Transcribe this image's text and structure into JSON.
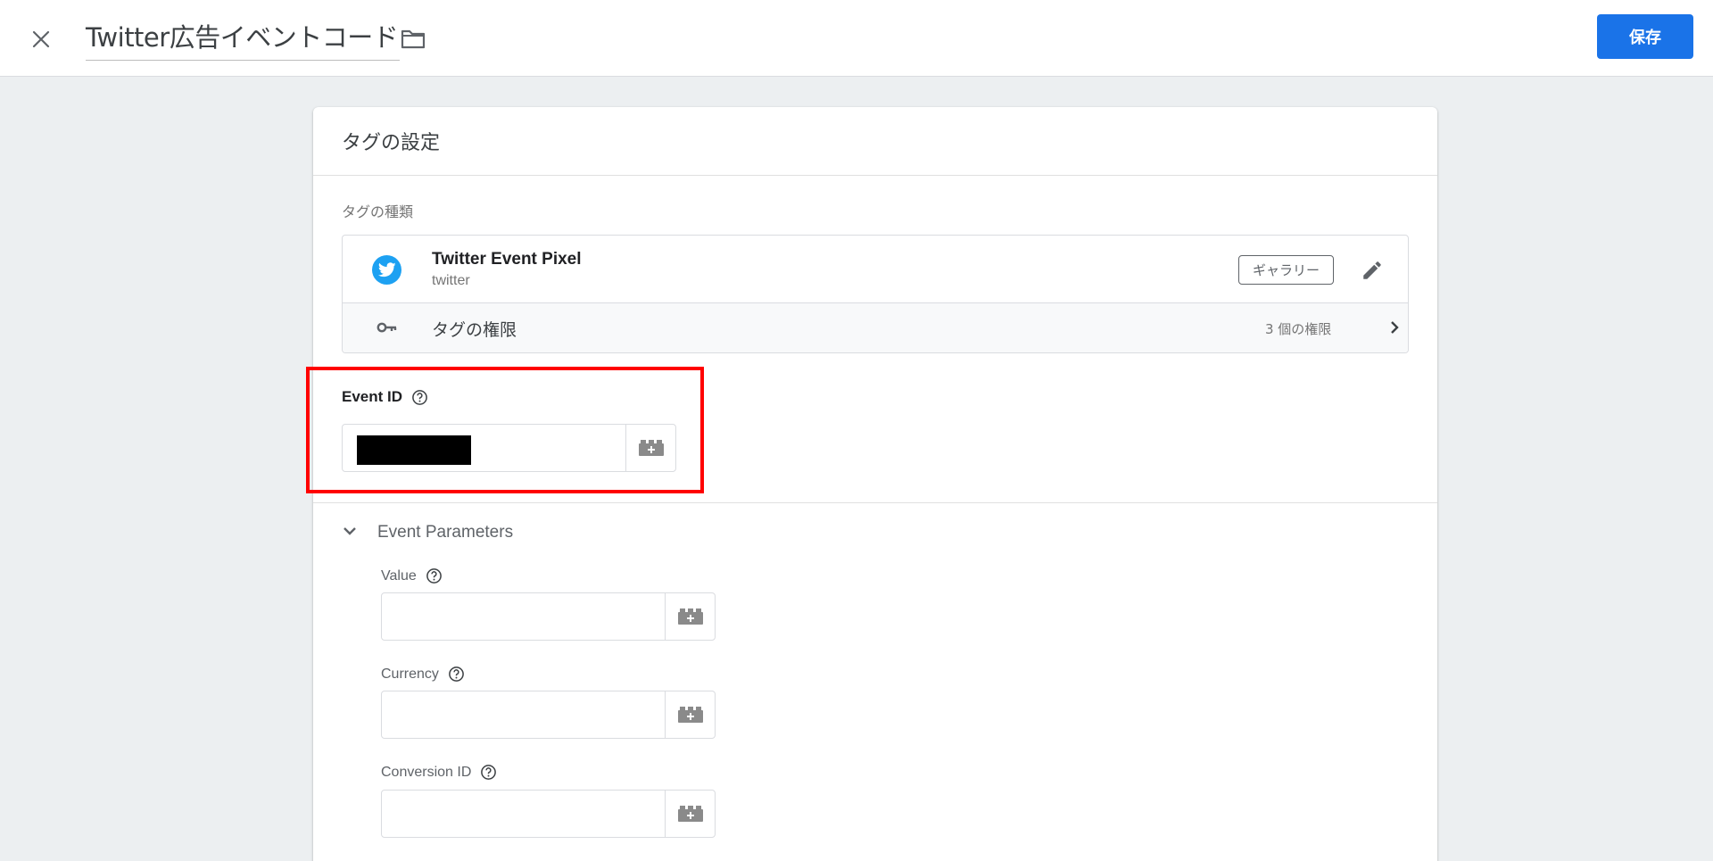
{
  "header": {
    "title": "Twitter広告イベントコード",
    "save_label": "保存"
  },
  "card": {
    "title": "タグの設定",
    "tag_type_label": "タグの種類",
    "tag": {
      "name": "Twitter Event Pixel",
      "vendor": "twitter",
      "badge": "ギャラリー",
      "icon": "twitter-bird-icon"
    },
    "permissions": {
      "label": "タグの権限",
      "count": "3 個の権限"
    },
    "event_id": {
      "label": "Event ID",
      "value": ""
    },
    "event_parameters": {
      "label": "Event Parameters",
      "fields": [
        {
          "label": "Value",
          "value": ""
        },
        {
          "label": "Currency",
          "value": ""
        },
        {
          "label": "Conversion ID",
          "value": ""
        }
      ]
    }
  },
  "colors": {
    "accent": "#1a73e8",
    "highlight": "#ff0000",
    "twitter": "#1da1f2",
    "background": "#eceff1"
  }
}
